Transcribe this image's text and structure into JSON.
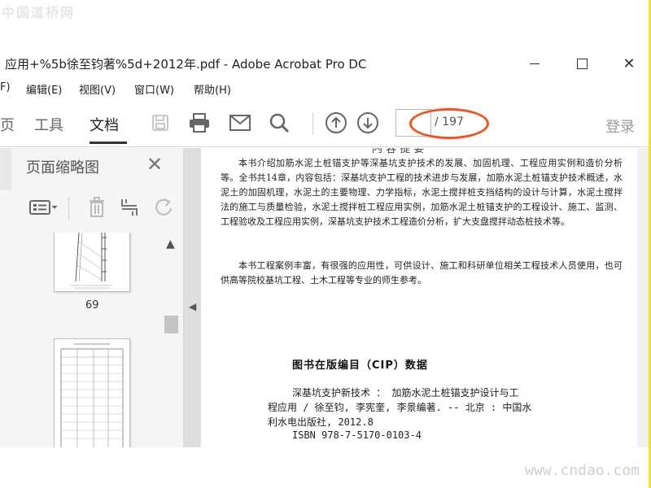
{
  "watermarks": {
    "top": "中国道桥网",
    "bottom": "www.cndao.com"
  },
  "window": {
    "title": "应用+%5b徐至钧著%5d+2012年.pdf - Adobe Acrobat Pro DC",
    "close_glyph": "✕"
  },
  "menubar": {
    "items": [
      "F)",
      "编辑(E)",
      "视图(V)",
      "窗口(W)",
      "帮助(H)"
    ]
  },
  "toolbar": {
    "tabs": [
      "页",
      "工具",
      "文档"
    ],
    "active_tab": "文档",
    "page_input_value": "",
    "page_total": "/ 197",
    "login": "登录",
    "icons": [
      "save-icon",
      "print-icon",
      "email-icon",
      "search-icon",
      "prev-page-icon",
      "next-page-icon"
    ]
  },
  "left_panel": {
    "title": "页面缩略图",
    "close_glyph": "✕",
    "tools": [
      "options-icon",
      "delete-icon",
      "crop-icon",
      "rotate-icon"
    ],
    "thumbnails": [
      {
        "label": "69"
      },
      {
        "label": ""
      }
    ]
  },
  "document": {
    "cut_heading": "内 容 提 要",
    "paragraphs": [
      "本书介绍加筋水泥土桩锚支护等深基坑支护技术的发展、加固机理、工程应用实例和造价分析等。全书共14章，内容包括：深基坑支护工程的技术进步与发展，加筋水泥土桩锚支护技术概述，水泥土的加固机理，水泥土的主要物理、力学指标，水泥土搅拌桩支挡结构的设计与计算，水泥土搅拌法的施工与质量检验，水泥土搅拌桩工程应用实例，加筋水泥土桩锚支护的工程设计、施工、监测、工程验收及工程应用实例，深基坑支护技术工程造价分析，扩大支盘搅拌动态桩技术等。",
      "本书工程案例丰富，有很强的应用性，可供设计、施工和科研单位相关工程技术人员使用，也可供高等院校基坑工程、土木工程等专业的师生参考。"
    ],
    "cip_title": "图书在版编目（CIP）数据",
    "cip_lines": [
      "深基坑支护新技术 ： 加筋水泥土桩锚支护设计与工",
      "程应用 / 徐至钧, 李宪奎, 李景编著. -- 北京 : 中国水",
      "利水电出版社, 2012.8",
      "ISBN 978-7-5170-0103-4"
    ]
  },
  "colors": {
    "annotation_ellipse": "#e25a2e",
    "frame_border": "#f0de3c"
  }
}
